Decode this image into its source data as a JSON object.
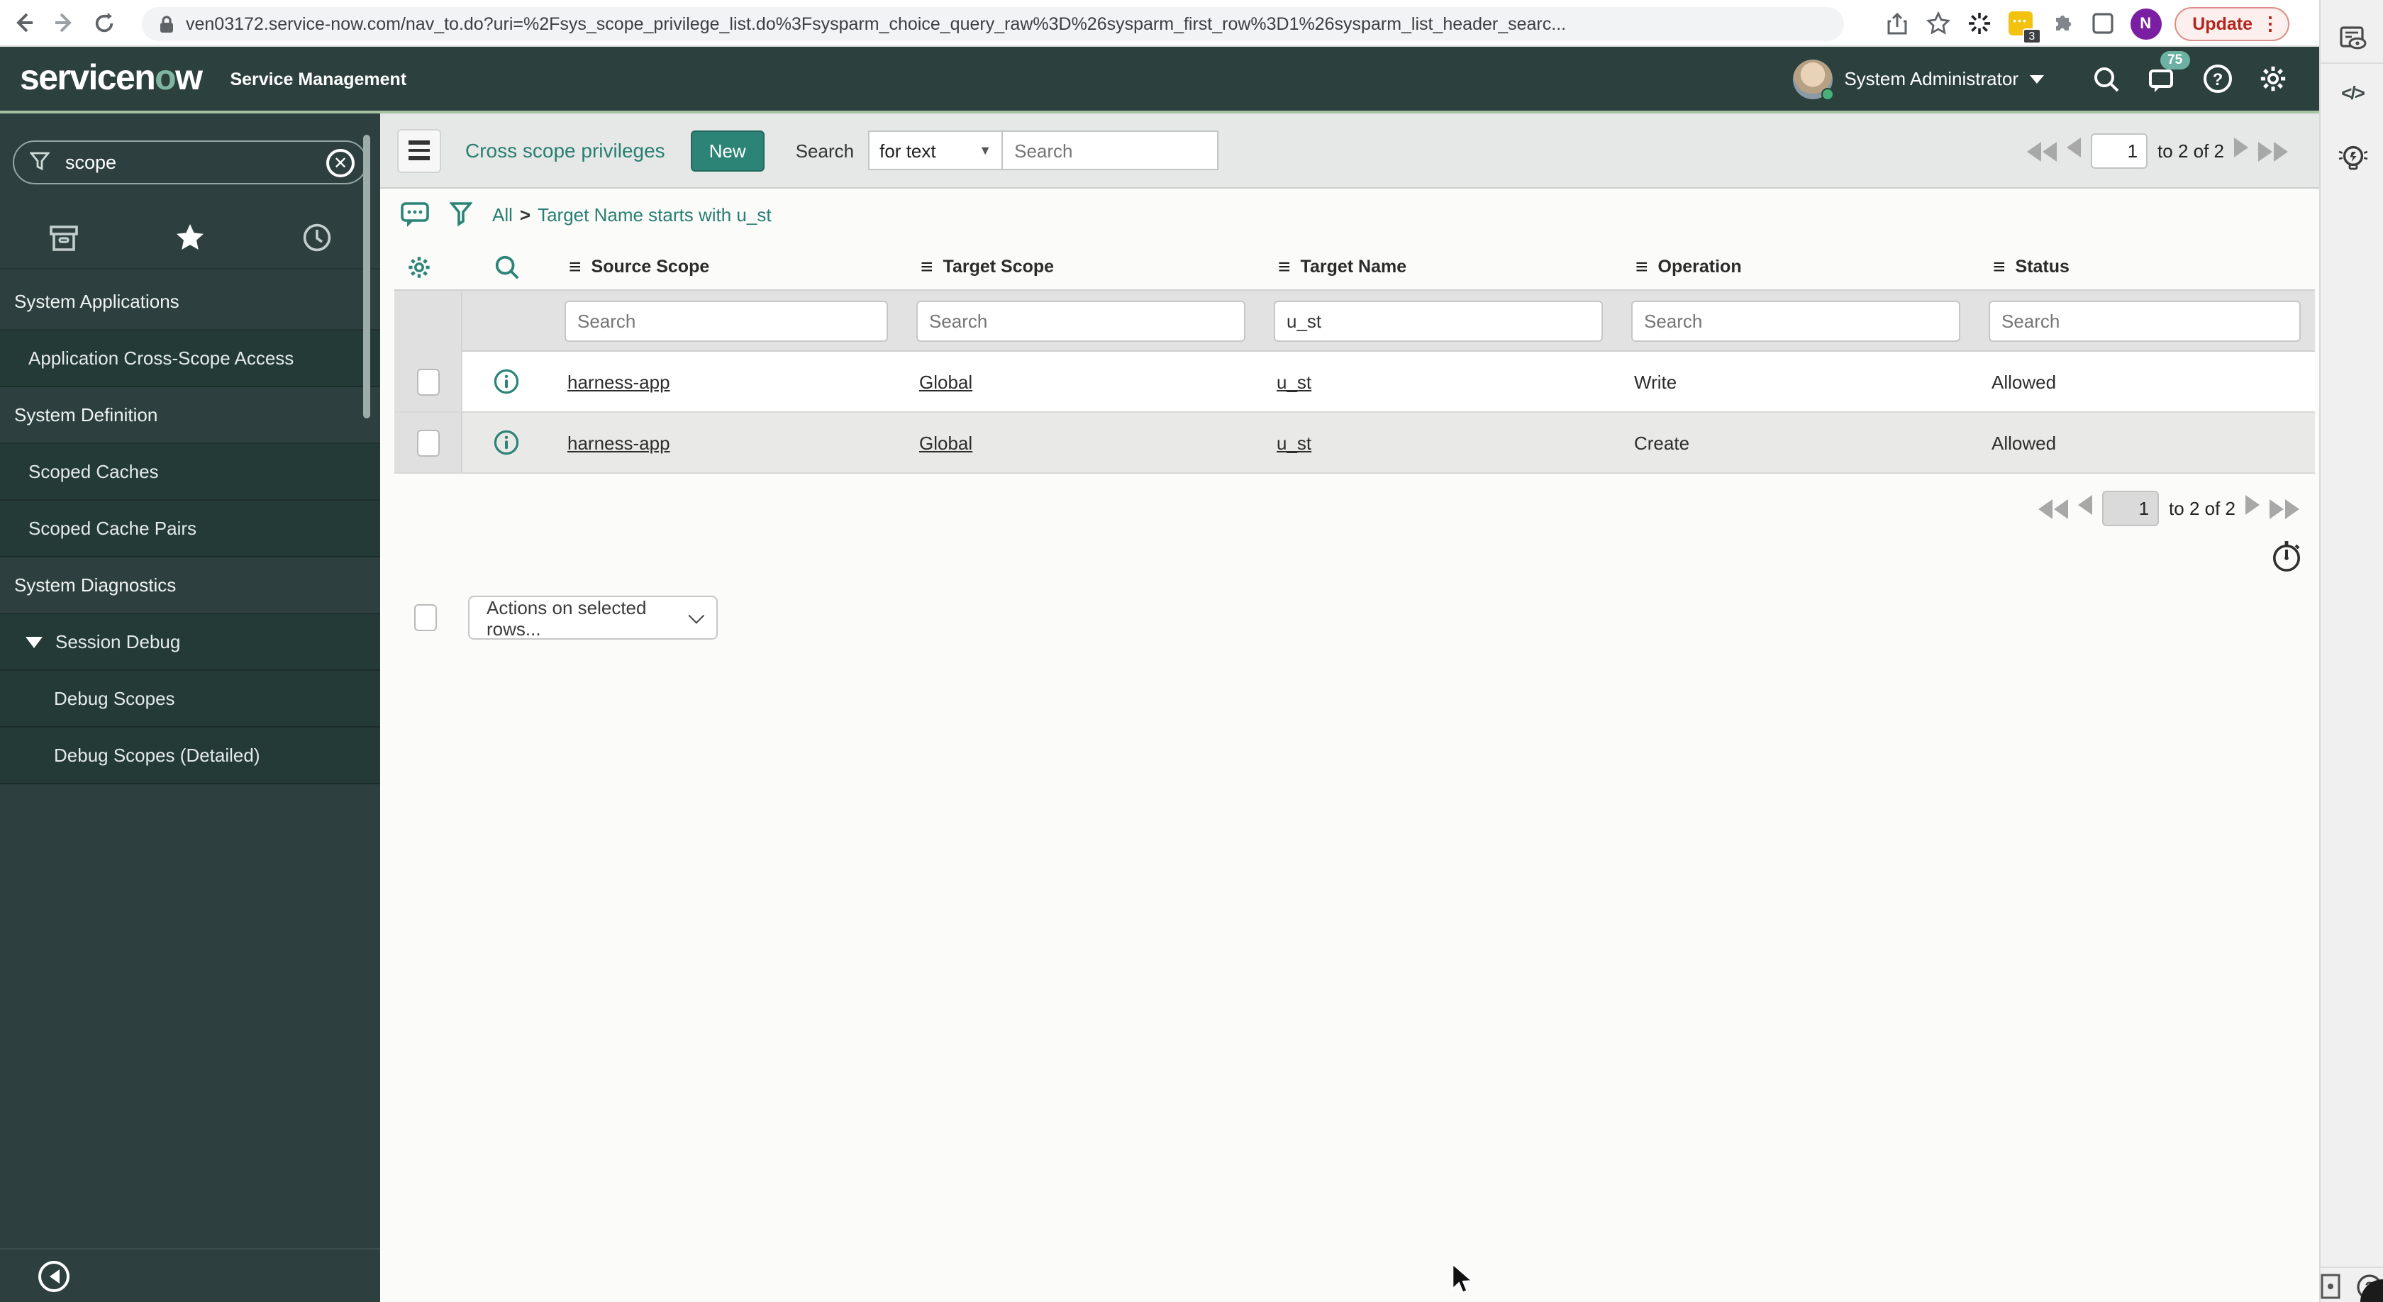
{
  "browser": {
    "url": "ven03172.service-now.com/nav_to.do?uri=%2Fsys_scope_privilege_list.do%3Fsysparm_choice_query_raw%3D%26sysparm_first_row%3D1%26sysparm_list_header_searc...",
    "update_label": "Update",
    "extension_badge": "3",
    "profile_letter": "N"
  },
  "header": {
    "logo_1": "servicen",
    "logo_o": "o",
    "logo_2": "w",
    "product": "Service Management",
    "user": "System Administrator",
    "notification_count": "75"
  },
  "sidebar": {
    "filter_value": "scope",
    "items": [
      {
        "label": "System Applications"
      },
      {
        "label": "Application Cross-Scope Access"
      },
      {
        "label": "System Definition"
      },
      {
        "label": "Scoped Caches"
      },
      {
        "label": "Scoped Cache Pairs"
      },
      {
        "label": "System Diagnostics"
      },
      {
        "label": "Session Debug"
      },
      {
        "label": "Debug Scopes"
      },
      {
        "label": "Debug Scopes (Detailed)"
      }
    ]
  },
  "toolbar": {
    "title": "Cross scope privileges",
    "new_label": "New",
    "search_label": "Search",
    "search_type": "for text",
    "search_placeholder": "Search"
  },
  "breadcrumb": {
    "all": "All",
    "sep": ">",
    "condition": "Target Name starts with u_st"
  },
  "table": {
    "columns": [
      "Source Scope",
      "Target Scope",
      "Target Name",
      "Operation",
      "Status"
    ],
    "search_row": {
      "c0_placeholder": "Search",
      "c1_placeholder": "Search",
      "c2_value": "u_st",
      "c3_placeholder": "Search",
      "c4_placeholder": "Search"
    },
    "rows": [
      {
        "source_scope": "harness-app",
        "target_scope": "Global",
        "target_name": "u_st",
        "operation": "Write",
        "status": "Allowed"
      },
      {
        "source_scope": "harness-app",
        "target_scope": "Global",
        "target_name": "u_st",
        "operation": "Create",
        "status": "Allowed"
      }
    ],
    "actions_label": "Actions on selected rows..."
  },
  "pagination": {
    "page": "1",
    "range": "to 2 of 2"
  },
  "colors": {
    "accent": "#2b8476",
    "header_bg": "#2c403d",
    "sidebar_bg": "#2d403f",
    "link": "#287e71"
  }
}
